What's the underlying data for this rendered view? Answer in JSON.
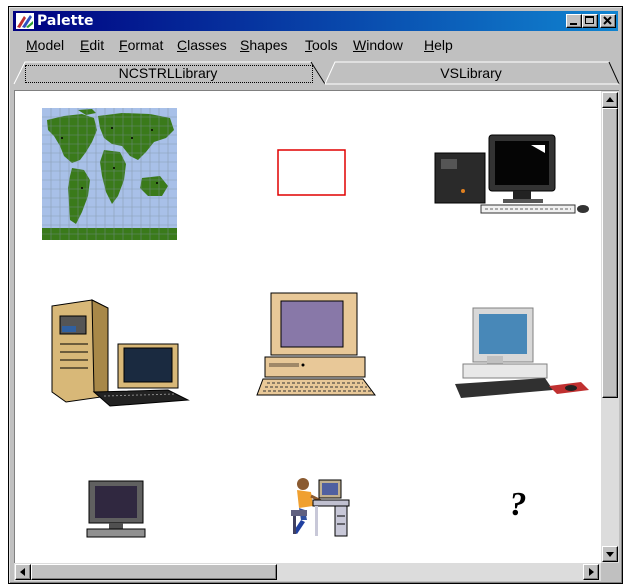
{
  "window": {
    "title": "Palette",
    "controls": [
      "minimize-icon",
      "maximize-icon",
      "close-icon"
    ]
  },
  "menu": {
    "items": [
      "Model",
      "Edit",
      "Format",
      "Classes",
      "Shapes",
      "Tools",
      "Window",
      "Help"
    ]
  },
  "tabs": [
    {
      "label": "NCSTRLLibrary",
      "selected": true
    },
    {
      "label": "VSLibrary",
      "selected": false
    }
  ],
  "palette_items": [
    {
      "icon": "world-map-icon"
    },
    {
      "icon": "red-rectangle-icon"
    },
    {
      "icon": "desktop-workstation-icon"
    },
    {
      "icon": "tower-server-icon"
    },
    {
      "icon": "beige-computer-icon"
    },
    {
      "icon": "silver-computer-icon"
    },
    {
      "icon": "monitor-icon"
    },
    {
      "icon": "person-at-computer-icon"
    },
    {
      "icon": "question-mark-icon",
      "text": "?"
    }
  ],
  "colors": {
    "title_bar_start": "#000080",
    "title_bar_end": "#1084d0",
    "window_face": "#c0c0c0",
    "map_land": "#3a7a1a",
    "map_sea": "#a8c0e8",
    "shape_red": "#e00000"
  }
}
